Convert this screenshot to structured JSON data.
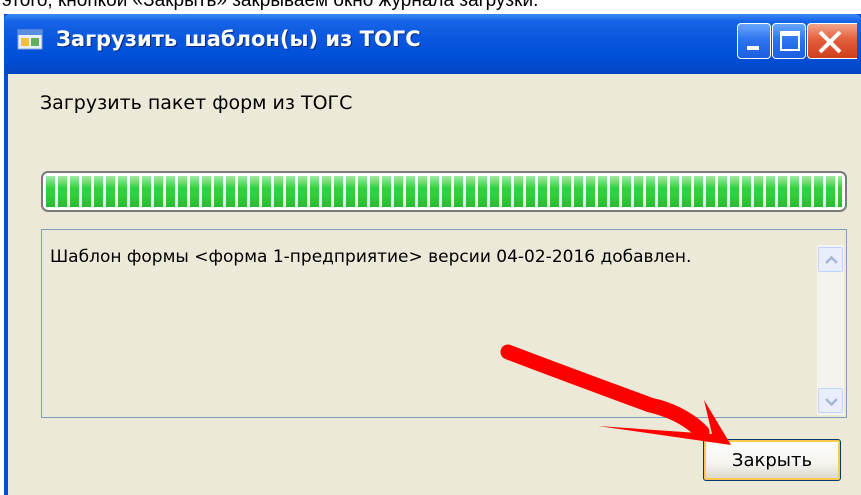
{
  "caption": {
    "text": "этого, кнопкой «Закрыть» закрываем окно журнала загрузки."
  },
  "window": {
    "title": "Загрузить шаблон(ы) из ТОГС",
    "header_label": "Загрузить пакет форм из ТОГС",
    "progress": {
      "percent": 100,
      "color": "#2fd23a"
    },
    "log": {
      "text": "Шаблон формы <форма 1-предприятие> версии 04-02-2016 добавлен."
    },
    "close_button_label": "Закрыть"
  },
  "icons": {
    "app": "window-app-icon",
    "minimize": "minimize-icon",
    "maximize": "maximize-icon",
    "close": "close-icon",
    "scroll_up": "chevron-up-icon",
    "scroll_down": "chevron-down-icon",
    "annotation": "red-arrow-icon"
  },
  "colors": {
    "titlebar": "#0050d8",
    "client": "#ece9d8",
    "close_title_button": "#e45f3c",
    "annotation_arrow": "#ff0000"
  }
}
